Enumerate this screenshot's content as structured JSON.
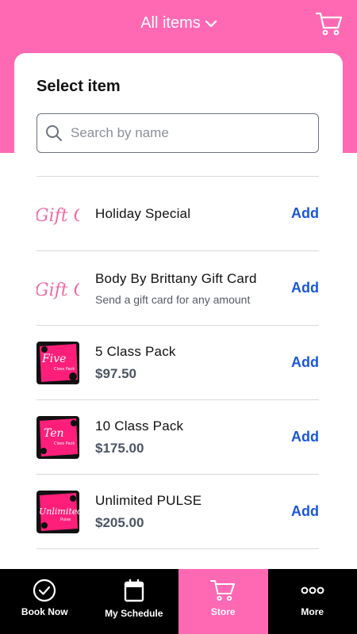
{
  "header": {
    "title": "All items",
    "chevron_icon": "chevron-down-icon",
    "cart_icon": "cart-icon"
  },
  "colors": {
    "brand_pink": "#ff69b4",
    "link_blue": "#1a56db",
    "tabbar_bg": "#000000"
  },
  "sheet": {
    "title": "Select item",
    "search": {
      "placeholder": "Search by name",
      "value": ""
    }
  },
  "items": [
    {
      "name": "Holiday Special",
      "sub": "",
      "price": "",
      "add_label": "Add",
      "thumb": "gift-card-image"
    },
    {
      "name": "Body By Brittany Gift Card",
      "sub": "Send a gift card for any amount",
      "price": "",
      "add_label": "Add",
      "thumb": "gift-card-image"
    },
    {
      "name": "5 Class Pack",
      "sub": "",
      "price": "$97.50",
      "add_label": "Add",
      "thumb": "five-class-pack-image"
    },
    {
      "name": "10 Class Pack",
      "sub": "",
      "price": "$175.00",
      "add_label": "Add",
      "thumb": "ten-class-pack-image"
    },
    {
      "name": "Unlimited PULSE",
      "sub": "",
      "price": "$205.00",
      "add_label": "Add",
      "thumb": "unlimited-pulse-image"
    }
  ],
  "tabbar": {
    "tabs": [
      {
        "label": "Book Now",
        "icon": "check-circle-icon",
        "active": false
      },
      {
        "label": "My Schedule",
        "icon": "calendar-icon",
        "active": false
      },
      {
        "label": "Store",
        "icon": "cart-icon",
        "active": true
      },
      {
        "label": "More",
        "icon": "more-dots-icon",
        "active": false
      }
    ]
  }
}
